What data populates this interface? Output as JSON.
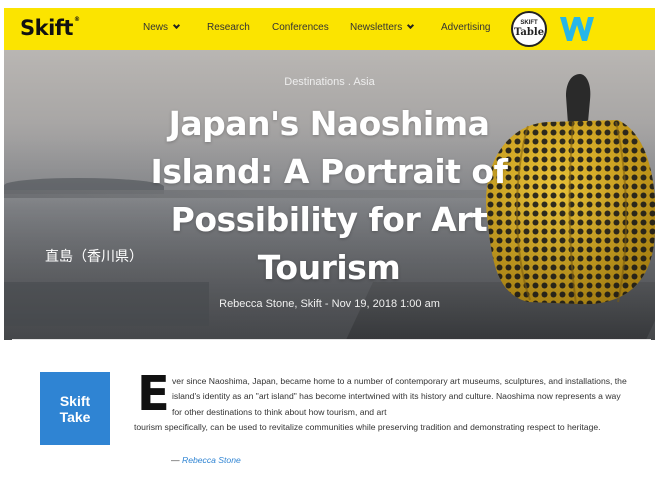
{
  "nav": {
    "logo": "Skift",
    "logo_mark": "®",
    "items": [
      "News",
      "Research",
      "Conferences",
      "Newsletters",
      "Advertising"
    ],
    "badge_table_top": "SKIFT",
    "badge_table_bottom": "Table",
    "w_logo_icon": "w-logo-icon"
  },
  "hero": {
    "category": "Destinations . Asia",
    "title": "Japan's Naoshima Island: A Portrait of Possibility for Art Tourism",
    "byline": "Rebecca Stone, Skift - Nov 19, 2018 1:00 am",
    "place_caption": "直島（香川県）"
  },
  "take": {
    "badge_line1": "Skift",
    "badge_line2": "Take",
    "drop_cap": "E",
    "text_lines_1": "ver since Naoshima, Japan, became home to a number of contemporary art museums, sculptures, and installations, the island's identity as an \"art island\" has become intertwined with its history and culture. Naoshima now represents a way for other destinations to think about how tourism, and art",
    "text_lines_2": "tourism specifically, can be used to revitalize communities while preserving tradition and demonstrating respect to heritage.",
    "author_dash": "— ",
    "author": "Rebecca Stone"
  },
  "colors": {
    "nav_yellow": "#fbe400",
    "take_blue": "#2f84d3",
    "pumpkin_yellow": "#e7b81f"
  }
}
